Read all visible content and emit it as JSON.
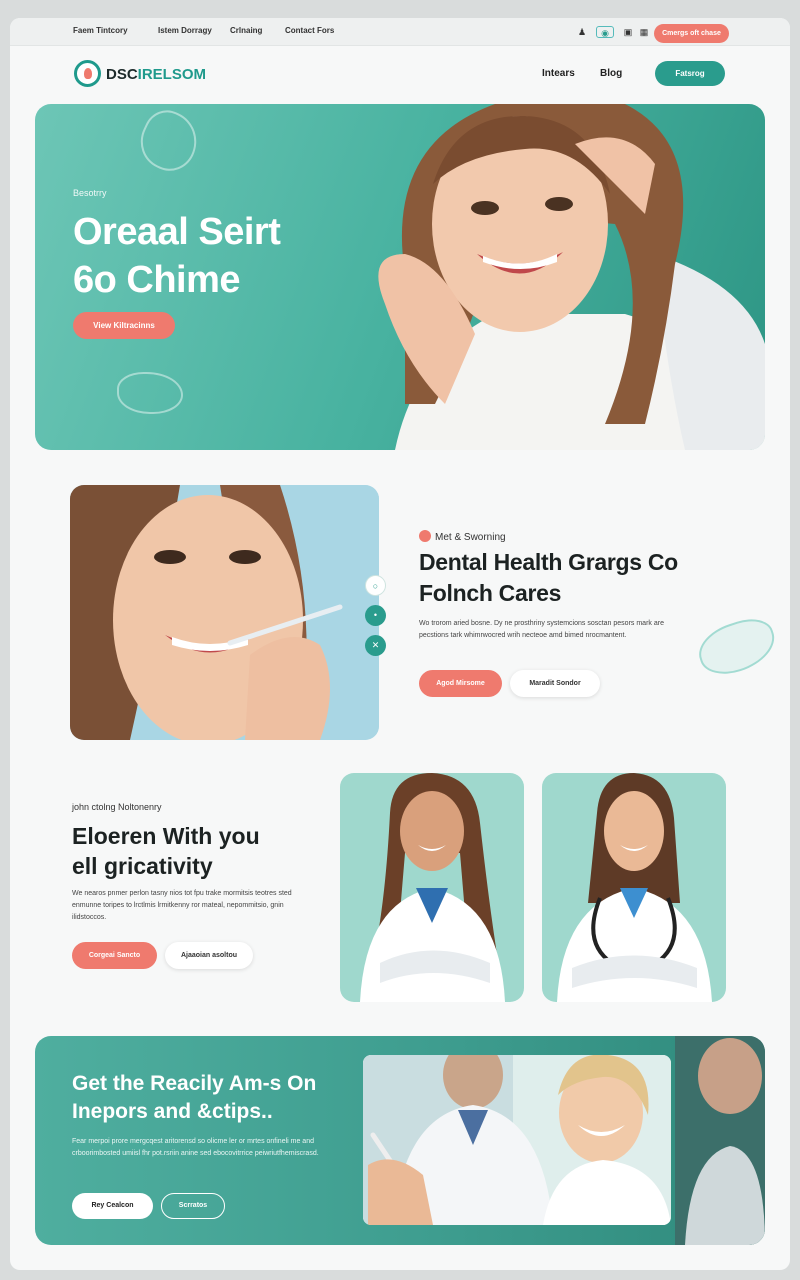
{
  "topbar": {
    "links": [
      "Faem Tintcory",
      "Istem Dorragy",
      "Crlnaing",
      "Contact Fors"
    ],
    "cta": "Cmergs oft chase"
  },
  "nav": {
    "logo_a": "DSC",
    "logo_b": "IRELSOM",
    "links": [
      "Intears",
      "Blog"
    ],
    "cta": "Fatsrog"
  },
  "hero": {
    "kicker": "Besotrry",
    "title_line1": "Oreaal Seirt",
    "title_line2": "6o Chime",
    "cta": "View Kiltracinns"
  },
  "section2": {
    "kicker": "Met & Sworning",
    "title_line1": "Dental Health Grargs Co",
    "title_line2": "Folnch Cares",
    "body": "Wo trorom aried bosne. Dy ne prosthriny systemcions sosctan pesors mark are pecstions tark whimrwocred wrih necteoe amd bimed nrocmantent.",
    "btn_primary": "Agod Mirsome",
    "btn_secondary": "Maradit Sondor"
  },
  "section3": {
    "kicker": "john ctolng Noltonenry",
    "title_line1": "Eloeren With you",
    "title_line2": "ell gricativity",
    "body": "We nearos pnmer perlon tasny nios tot fpu trake mormitsis teotres sted enmunne toripes to lrctlmis lrmitkenny ror mateal, nepommitsio, gnin ilidstoccos.",
    "btn_primary": "Corgeai Sancto",
    "btn_secondary": "Ajaaoian asoltou"
  },
  "banner": {
    "title_line1": "Get the Reacily Am-s On",
    "title_line2": "Inepors and &ctips..",
    "body": "Fear merpoi prore mergcqest aritorensd so olicme ler or mrtes onfineli me and crboorimbosted umiisl fhr pot.rsriin anine sed ebocovitrrice peiwriutfhemiscrasd.",
    "btn_primary": "Rey Cealcon",
    "btn_secondary": "Scrratos"
  },
  "colors": {
    "teal": "#2a9c8d",
    "coral": "#ef7a6e",
    "mint": "#9fd8cd"
  }
}
